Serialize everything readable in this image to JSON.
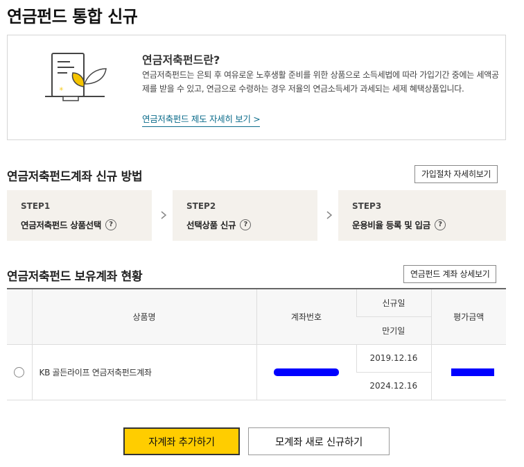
{
  "page": {
    "title": "연금펀드 통합 신규"
  },
  "intro": {
    "heading": "연금저축펀드란?",
    "text": "연금저축펀드는 은퇴 후 여유로운 노후생활 준비를 위한 상품으로 소득세법에 따라 가입기간 중에는 세액공제를 받을 수 있고, 연금으로 수령하는 경우 저율의 연금소득세가 과세되는 세제 혜택상품입니다.",
    "link_label": "연금저축펀드 제도 자세히 보기 >",
    "illustration_icon": "document-plant-icon"
  },
  "method": {
    "title": "연금저축펀드계좌 신규 방법",
    "detail_button": "가입절차 자세히보기",
    "steps": [
      {
        "label": "STEP1",
        "desc": "연금저축펀드 상품선택"
      },
      {
        "label": "STEP2",
        "desc": "선택상품 신규"
      },
      {
        "label": "STEP3",
        "desc": "운용비율 등록 및 입금"
      }
    ],
    "help_glyph": "?"
  },
  "holdings": {
    "title": "연금저축펀드 보유계좌 현황",
    "detail_button": "연금펀드 계좌 상세보기",
    "columns": {
      "product": "상품명",
      "account": "계좌번호",
      "open_date": "신규일",
      "maturity_date": "만기일",
      "valuation": "평가금액"
    },
    "rows": [
      {
        "product": "KB 골든라이프 연금저축펀드계좌",
        "open_date": "2019.12.16",
        "maturity_date": "2024.12.16"
      }
    ]
  },
  "actions": {
    "primary": "자계좌 추가하기",
    "secondary": "모계좌 새로 신규하기"
  },
  "colors": {
    "accent": "#ffcd00",
    "link": "#0a6b8a",
    "step_bg": "#f4f1ec",
    "mask": "#0000ff"
  }
}
